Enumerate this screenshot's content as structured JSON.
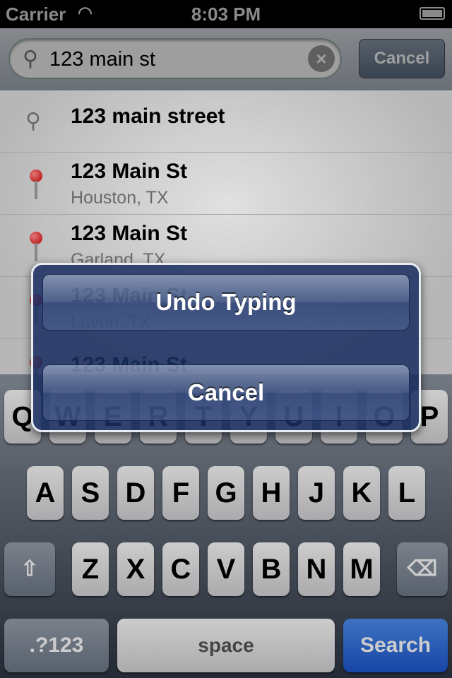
{
  "status": {
    "carrier": "Carrier",
    "time": "8:03 PM",
    "icons": [
      "wifi-icon",
      "battery-icon"
    ]
  },
  "search": {
    "value": "123 main st",
    "cancel": "Cancel"
  },
  "results": [
    {
      "title": "123 main street",
      "subtitle": "",
      "icon": "search-icon"
    },
    {
      "title": "123 Main St",
      "subtitle": "Houston, TX",
      "icon": "pin-icon"
    },
    {
      "title": "123 Main St",
      "subtitle": "Garland, TX",
      "icon": "pin-icon"
    },
    {
      "title": "123 Main St",
      "subtitle": "Lavon, TX",
      "icon": "pin-icon"
    },
    {
      "title": "123 Main St",
      "subtitle": "",
      "icon": "pin-icon"
    }
  ],
  "keyboard": {
    "row1": [
      "Q",
      "W",
      "E",
      "R",
      "T",
      "Y",
      "U",
      "I",
      "O",
      "P"
    ],
    "row2": [
      "A",
      "S",
      "D",
      "F",
      "G",
      "H",
      "J",
      "K",
      "L"
    ],
    "row3": [
      "Z",
      "X",
      "C",
      "V",
      "B",
      "N",
      "M"
    ],
    "numbers": ".?123",
    "space": "space",
    "search": "Search",
    "search_color": "#1d57d0"
  },
  "alert": {
    "undo": "Undo Typing",
    "cancel": "Cancel"
  }
}
